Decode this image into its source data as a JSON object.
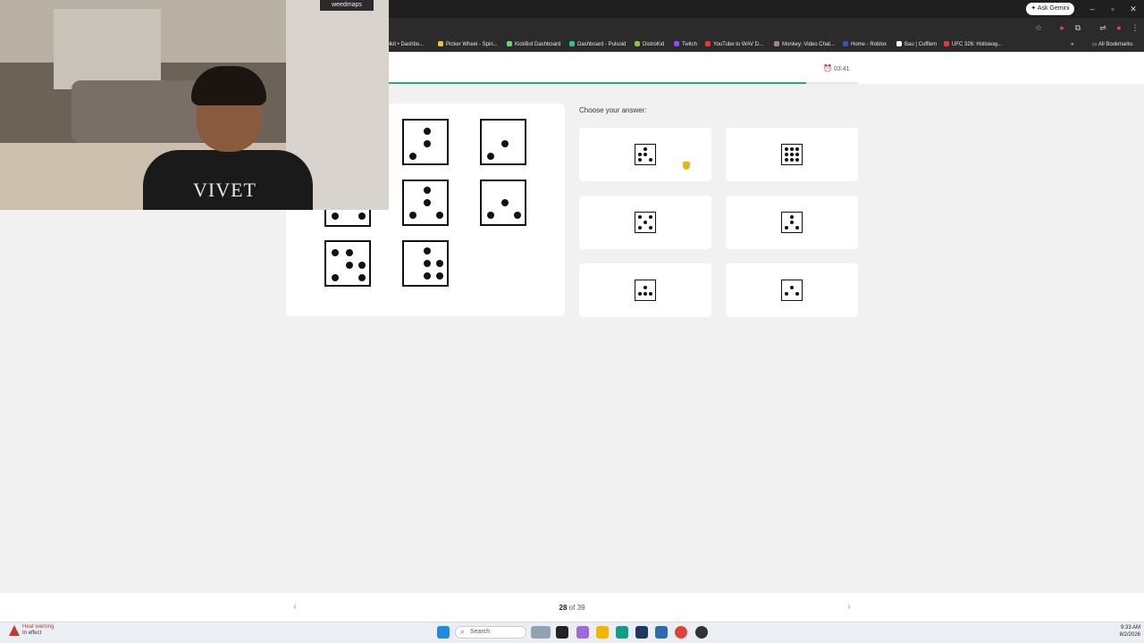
{
  "browser": {
    "gemini_label": "Ask Gemini",
    "bookmarks": [
      {
        "label": "oolkit • Dashbo...",
        "color": "#d9a441"
      },
      {
        "label": "Picker Wheel - Spin...",
        "color": "#f2c12e"
      },
      {
        "label": "KickBot Dashboard",
        "color": "#6fd36f"
      },
      {
        "label": "Dashboard - Pulsoid",
        "color": "#35c28b"
      },
      {
        "label": "DistroKid",
        "color": "#8bc34a"
      },
      {
        "label": "Twitch",
        "color": "#9146ff"
      },
      {
        "label": "YouTube to WAV D...",
        "color": "#e53935"
      },
      {
        "label": "Monkey: Video Chat...",
        "color": "#a1887f"
      },
      {
        "label": "Home - Roblox",
        "color": "#3f51b5"
      },
      {
        "label": "Bau | Cufflem",
        "color": "#ffffff"
      },
      {
        "label": "UFC 326: Holloway...",
        "color": "#e53935"
      }
    ],
    "all_bookmarks": "All Bookmarks"
  },
  "quiz": {
    "timer": "03:41",
    "progress_fraction": 0.91,
    "choose_label": "Choose your answer:",
    "question_mark": "?",
    "pager": {
      "current": "28",
      "of_text": "of 39",
      "prev": "‹",
      "next": "›"
    }
  },
  "webcam": {
    "banner": "weedmaps",
    "shirt_text": "VIVET"
  },
  "taskbar": {
    "heat_title": "Heat warning",
    "heat_sub": "In effect",
    "search_label": "Search",
    "time": "9:33 AM",
    "date": "8/2/2026"
  }
}
